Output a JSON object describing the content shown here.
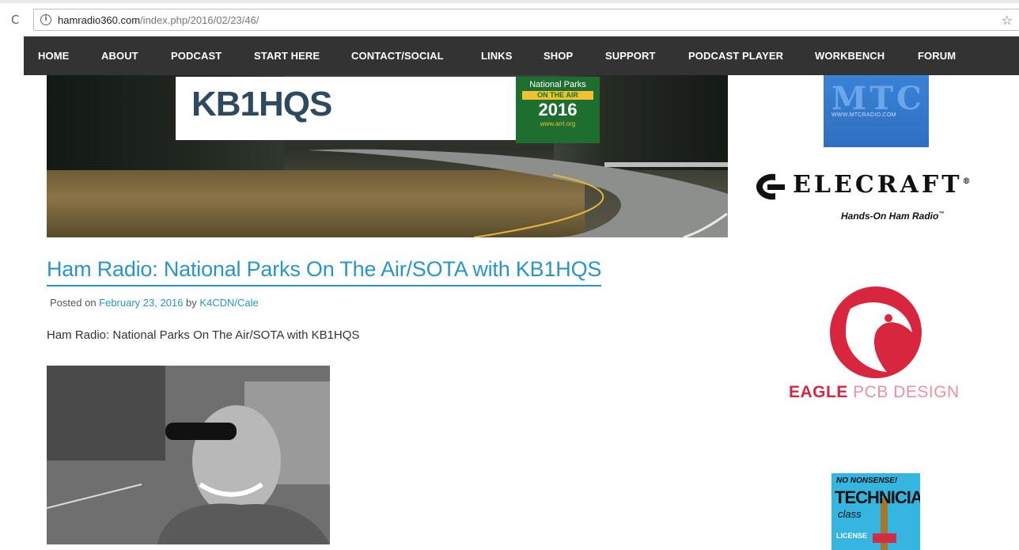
{
  "browser": {
    "url_host": "hamradio360.com",
    "url_path": "/index.php/2016/02/23/46/"
  },
  "nav": {
    "items": [
      {
        "label": "HOME",
        "name": "nav-home"
      },
      {
        "label": "ABOUT",
        "name": "nav-about"
      },
      {
        "label": "PODCAST",
        "name": "nav-podcast"
      },
      {
        "label": "START HERE",
        "name": "nav-start-here"
      },
      {
        "label": "CONTACT/SOCIAL",
        "name": "nav-contact-social"
      },
      {
        "label": "LINKS",
        "name": "nav-links"
      },
      {
        "label": "SHOP",
        "name": "nav-shop"
      },
      {
        "label": "SUPPORT",
        "name": "nav-support"
      },
      {
        "label": "PODCAST PLAYER",
        "name": "nav-podcast-player"
      },
      {
        "label": "WORKBENCH",
        "name": "nav-workbench"
      },
      {
        "label": "FORUM",
        "name": "nav-forum"
      }
    ]
  },
  "banner": {
    "callsign": "KB1HQS",
    "badge_line1": "National Parks",
    "badge_line2": "ON THE AIR",
    "badge_line3": "2016",
    "badge_line4": "www.arrl.org"
  },
  "post": {
    "title": "Ham Radio: National Parks On The Air/SOTA with KB1HQS",
    "meta_prefix": "Posted on ",
    "date": "February 23, 2016",
    "meta_by": " by ",
    "author": "K4CDN/Cale",
    "body": "Ham Radio: National Parks On The Air/SOTA with KB1HQS"
  },
  "sidebar": {
    "mtc_logo": "MTC",
    "mtc_url": "WWW.MTCRADIO.COM",
    "elecraft_name": "ELECRAFT",
    "elecraft_reg": "®",
    "elecraft_tagline": "Hands-On Ham Radio",
    "elecraft_tm": "™",
    "eagle_word": "EAGLE",
    "eagle_rest": " PCB DESIGN",
    "tech_line1": "NO NONSENSE!",
    "tech_line2": "TECHNICIAN",
    "tech_line3": "class",
    "tech_line4": "LICENSE"
  },
  "colors": {
    "nav_bg": "#333333",
    "link": "#2a95c9",
    "eagle_red": "#d7263d"
  }
}
